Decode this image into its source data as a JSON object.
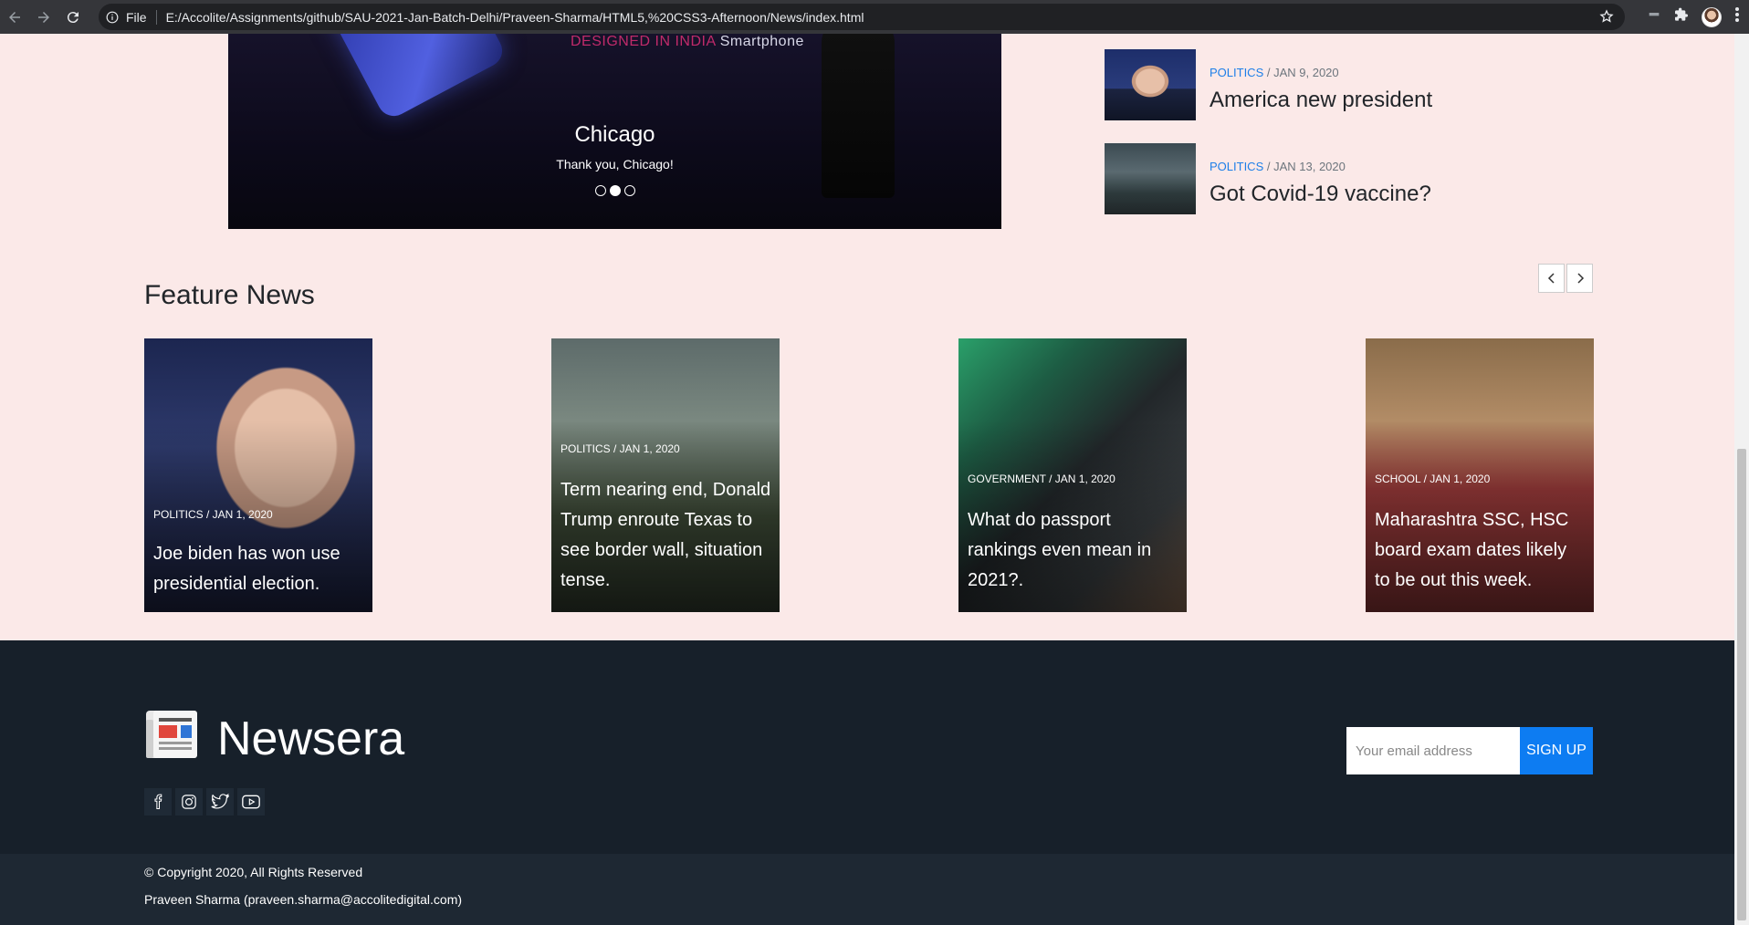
{
  "browser": {
    "scheme_label": "File",
    "url": "E:/Accolite/Assignments/github/SAU-2021-Jan-Batch-Delhi/Praveen-Sharma/HTML5,%20CSS3-Afternoon/News/index.html"
  },
  "carousel": {
    "promo_text_pink": "DESIGNED IN INDIA",
    "promo_text_white": " Smartphone",
    "caption_title": "Chicago",
    "caption_text": "Thank you, Chicago!",
    "slide_count": 3,
    "active_slide": 2
  },
  "side_news": [
    {
      "category": "POLITICS",
      "date": " / JAN 9, 2020",
      "title": "America new president"
    },
    {
      "category": "POLITICS",
      "date": " / JAN 13, 2020",
      "title": "Got Covid-19 vaccine?"
    }
  ],
  "feature": {
    "heading": "Feature News",
    "prev_icon": "chevron-left-icon",
    "next_icon": "chevron-right-icon",
    "cards": [
      {
        "meta": "POLITICS / JAN 1, 2020",
        "title": "Joe biden has won use presidential election."
      },
      {
        "meta": "POLITICS / JAN 1, 2020",
        "title": "Term nearing end, Donald Trump enroute Texas to see border wall, situation tense."
      },
      {
        "meta": "GOVERNMENT / JAN 1, 2020",
        "title": "What do passport rankings even mean in 2021?."
      },
      {
        "meta": "SCHOOL / JAN 1, 2020",
        "title": "Maharashtra SSC, HSC board exam dates likely to be out this week."
      }
    ]
  },
  "footer": {
    "brand": "Newsera",
    "email_placeholder": "Your email address",
    "signup_label": "SIGN UP",
    "copyright": "© Copyright 2020, All Rights Reserved",
    "author": "Praveen Sharma (praveen.sharma@accolitedigital.com)",
    "socials": [
      "facebook-icon",
      "instagram-icon",
      "twitter-icon",
      "youtube-icon"
    ]
  },
  "colors": {
    "accent": "#0d7cf2",
    "category": "#1e7fe8",
    "footer_bg": "#17202a",
    "page_bg": "#fbe9e8"
  }
}
